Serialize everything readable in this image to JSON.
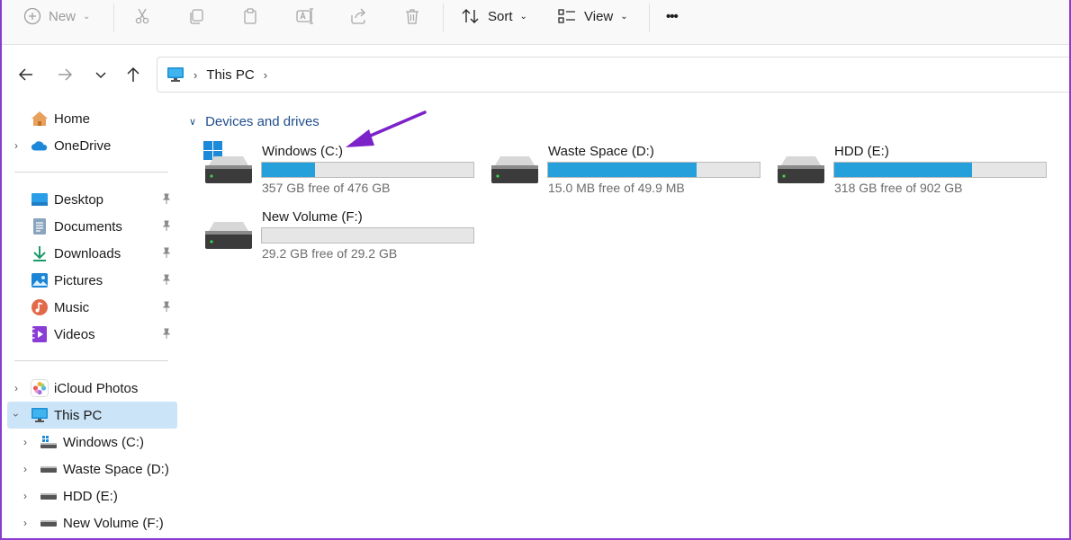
{
  "toolbar": {
    "new_label": "New",
    "sort_label": "Sort",
    "view_label": "View",
    "more_label": "•••"
  },
  "address": {
    "crumb": "This PC"
  },
  "sidebar": {
    "items": [
      {
        "label": "Home"
      },
      {
        "label": "OneDrive"
      },
      {
        "label": "Desktop"
      },
      {
        "label": "Documents"
      },
      {
        "label": "Downloads"
      },
      {
        "label": "Pictures"
      },
      {
        "label": "Music"
      },
      {
        "label": "Videos"
      },
      {
        "label": "iCloud Photos"
      },
      {
        "label": "This PC"
      },
      {
        "label": "Windows (C:)"
      },
      {
        "label": "Waste Space (D:)"
      },
      {
        "label": "HDD (E:)"
      },
      {
        "label": "New Volume (F:)"
      }
    ]
  },
  "main": {
    "group_title": "Devices and drives",
    "drives": [
      {
        "name": "Windows (C:)",
        "free": "357 GB free of 476 GB",
        "used_fraction": 0.25
      },
      {
        "name": "Waste Space (D:)",
        "free": "15.0 MB free of 49.9 MB",
        "used_fraction": 0.7
      },
      {
        "name": "HDD (E:)",
        "free": "318 GB free of 902 GB",
        "used_fraction": 0.65
      },
      {
        "name": "New Volume (F:)",
        "free": "29.2 GB free of 29.2 GB",
        "used_fraction": 0.0
      }
    ]
  },
  "colors": {
    "accent": "#26a0da",
    "selection": "#cce4f7",
    "annotation_arrow": "#7b22c9"
  }
}
